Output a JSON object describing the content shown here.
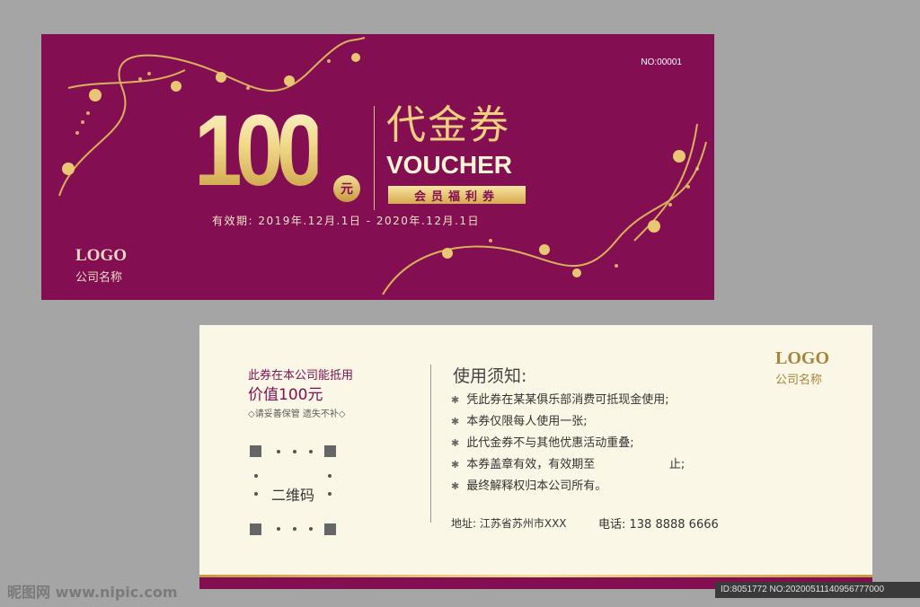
{
  "front": {
    "voucher_no": "NO:00001",
    "amount": "100",
    "yuan": "元",
    "title_cn": "代金券",
    "title_en": "VOUCHER",
    "member_badge": "会员福利券",
    "validity": "有效期: 2019年.12月.1日 - 2020年.12月.1日",
    "logo": "LOGO",
    "company": "公司名称",
    "colors": {
      "background": "#830f52",
      "gold": "#f0cf7e"
    }
  },
  "back": {
    "deduct_text": "此券在本公司能抵用",
    "worth_text": "价值100元",
    "keep_text": "◇请妥善保管 遗失不补◇",
    "qr_label": "二维码",
    "notice_title": "使用须知:",
    "rules": [
      "凭此券在某某俱乐部消费可抵现金使用;",
      "本券仅限每人使用一张;",
      "此代金券不与其他优惠活动重叠;",
      "本券盖章有效，有效期至                    止;",
      "最终解释权归本公司所有。"
    ],
    "address": "地址: 江苏省苏州市XXX",
    "phone": "电话: 138 8888 6666",
    "logo": "LOGO",
    "company": "公司名称"
  },
  "watermark": "昵图网 www.nipic.com",
  "id_strip": "ID:8051772 NO:20200511140956777000"
}
